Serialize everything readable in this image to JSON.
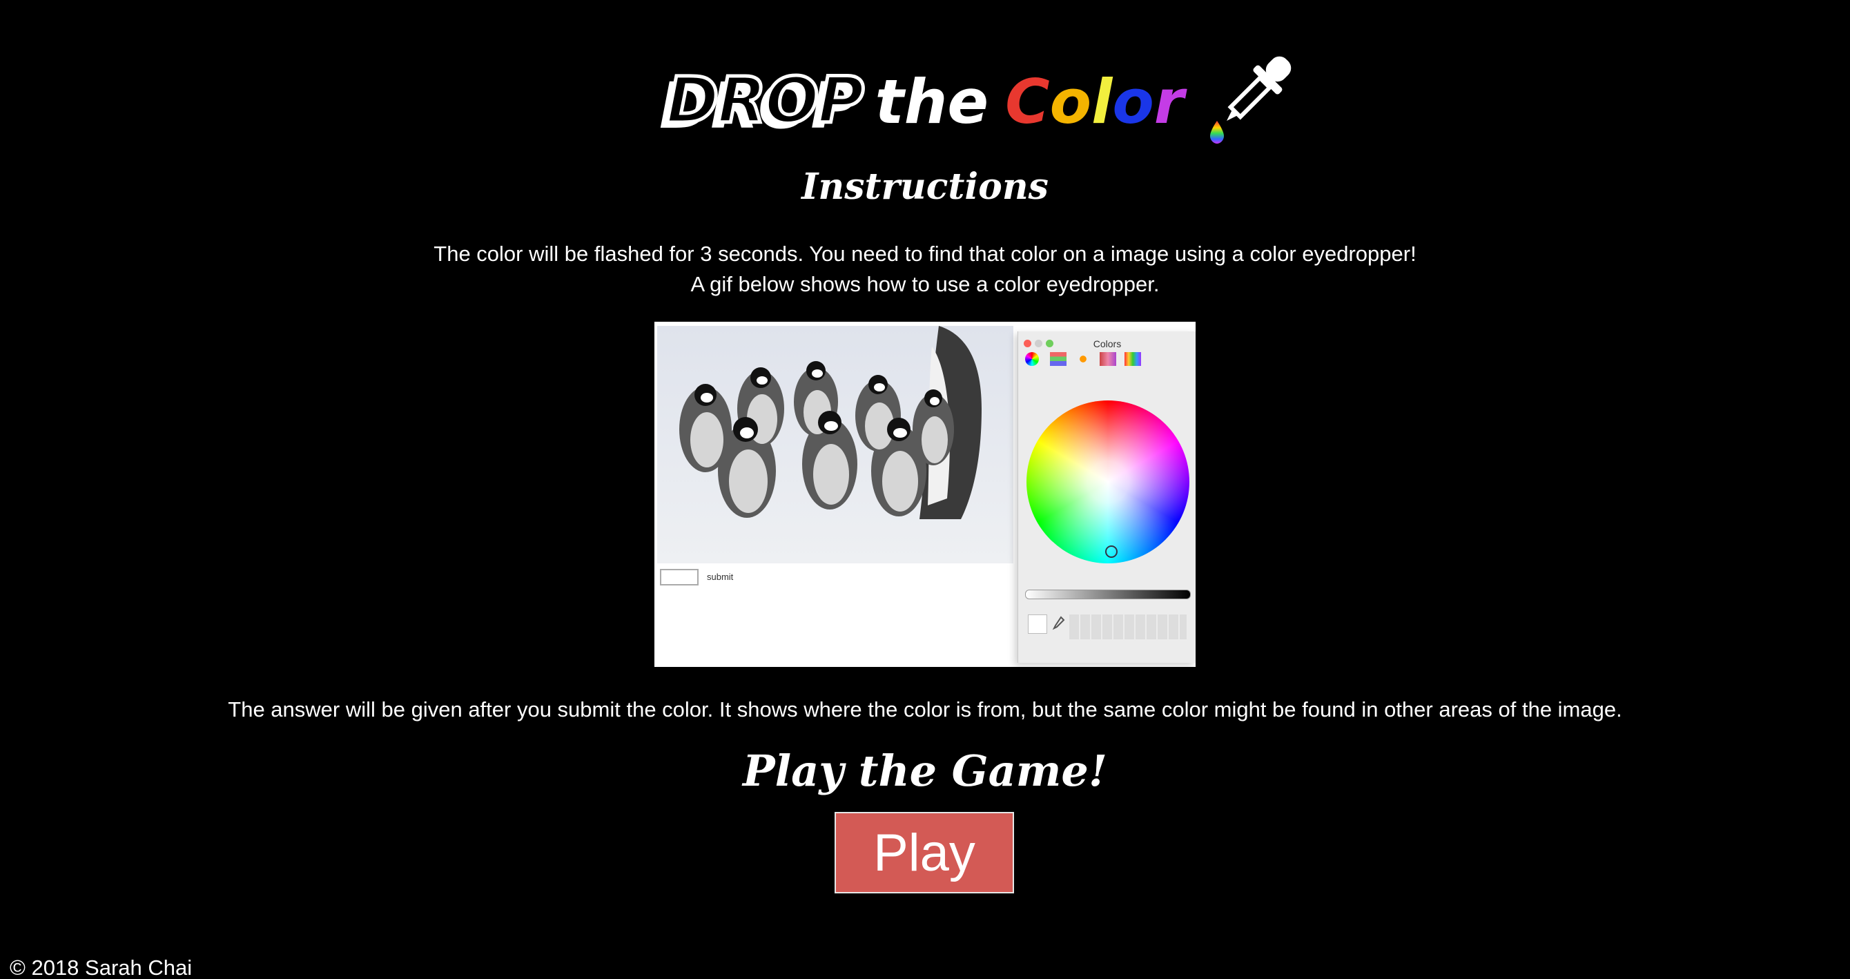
{
  "logo": {
    "drop": "DROP",
    "the": "the",
    "color_letters": [
      {
        "char": "C",
        "color": "#e8382f"
      },
      {
        "char": "o",
        "color": "#f4b400"
      },
      {
        "char": "l",
        "color": "#f2ef3e"
      },
      {
        "char": "o",
        "color": "#1a36e8"
      },
      {
        "char": "r",
        "color": "#c43ce6"
      }
    ],
    "dropper_icon": "eyedropper-icon"
  },
  "instructions": {
    "title": "Instructions",
    "line1": "The color will be flashed for 3 seconds. You need to find that color on a image using a color eyedropper!",
    "line2": "A gif below shows how to use a color eyedropper.",
    "after": "The answer will be given after you submit the color. It shows where the color is from, but the same color might be found in other areas of the image."
  },
  "demo": {
    "window_title": "Colors",
    "submit_label": "submit"
  },
  "play": {
    "title": "Play the Game!",
    "button_label": "Play",
    "button_color": "#d35a55"
  },
  "footer": {
    "text": "© 2018 Sarah Chai"
  }
}
